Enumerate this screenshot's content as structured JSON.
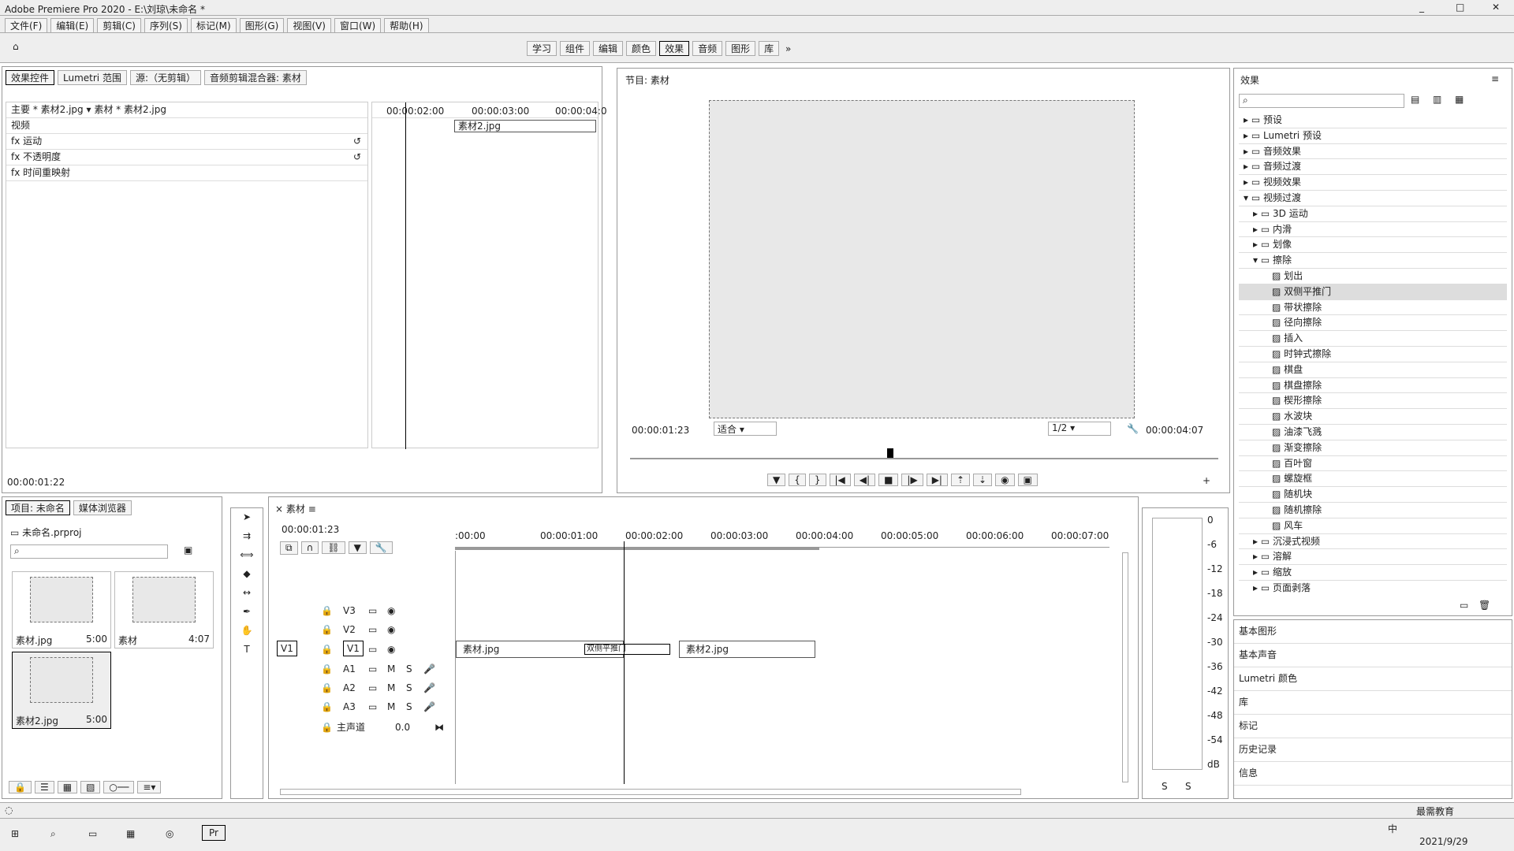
{
  "window": {
    "title": "Adobe Premiere Pro 2020 - E:\\刘琼\\未命名 *"
  },
  "menu": [
    "文件(F)",
    "编辑(E)",
    "剪辑(C)",
    "序列(S)",
    "标记(M)",
    "图形(G)",
    "视图(V)",
    "窗口(W)",
    "帮助(H)"
  ],
  "workspaces": {
    "items": [
      "学习",
      "组件",
      "编辑",
      "颜色",
      "效果",
      "音频",
      "图形",
      "库"
    ],
    "active": "效果"
  },
  "effect_controls": {
    "tabs": [
      "效果控件",
      "Lumetri 范围",
      "源:（无剪辑）",
      "音频剪辑混合器: 素材"
    ],
    "master": "主要 * 素材2.jpg",
    "clip": "素材 * 素材2.jpg",
    "ruler": [
      "00:00:02:00",
      "00:00:03:00",
      "00:00:04:0"
    ],
    "clip_label": "素材2.jpg",
    "section": "视频",
    "props": [
      "运动",
      "不透明度",
      "时间重映射"
    ],
    "fx": "fx",
    "timecode": "00:00:01:22"
  },
  "program": {
    "title": "节目: 素材",
    "timecode": "00:00:01:23",
    "fit": "适合",
    "quality": "1/2",
    "duration": "00:00:04:07"
  },
  "effects_panel": {
    "title": "效果",
    "tree": [
      {
        "label": "预设",
        "level": 0
      },
      {
        "label": "Lumetri 预设",
        "level": 0
      },
      {
        "label": "音频效果",
        "level": 0
      },
      {
        "label": "音频过渡",
        "level": 0
      },
      {
        "label": "视频效果",
        "level": 0
      },
      {
        "label": "视频过渡",
        "level": 0
      },
      {
        "label": "3D 运动",
        "level": 1
      },
      {
        "label": "内滑",
        "level": 1
      },
      {
        "label": "划像",
        "level": 1
      },
      {
        "label": "擦除",
        "level": 1
      },
      {
        "label": "划出",
        "level": 2
      },
      {
        "label": "双侧平推门",
        "level": 2,
        "selected": true
      },
      {
        "label": "带状擦除",
        "level": 2
      },
      {
        "label": "径向擦除",
        "level": 2
      },
      {
        "label": "插入",
        "level": 2
      },
      {
        "label": "时钟式擦除",
        "level": 2
      },
      {
        "label": "棋盘",
        "level": 2
      },
      {
        "label": "棋盘擦除",
        "level": 2
      },
      {
        "label": "楔形擦除",
        "level": 2
      },
      {
        "label": "水波块",
        "level": 2
      },
      {
        "label": "油漆飞溅",
        "level": 2
      },
      {
        "label": "渐变擦除",
        "level": 2
      },
      {
        "label": "百叶窗",
        "level": 2
      },
      {
        "label": "螺旋框",
        "level": 2
      },
      {
        "label": "随机块",
        "level": 2
      },
      {
        "label": "随机擦除",
        "level": 2
      },
      {
        "label": "风车",
        "level": 2
      },
      {
        "label": "沉浸式视频",
        "level": 1
      },
      {
        "label": "溶解",
        "level": 1
      },
      {
        "label": "缩放",
        "level": 1
      },
      {
        "label": "页面剥落",
        "level": 1
      }
    ],
    "sections": [
      "基本图形",
      "基本声音",
      "Lumetri 颜色",
      "库",
      "标记",
      "历史记录",
      "信息"
    ]
  },
  "project": {
    "tabs": [
      "项目: 未命名",
      "媒体浏览器"
    ],
    "file": "未命名.prproj",
    "items": [
      {
        "name": "素材.jpg",
        "duration": "5:00"
      },
      {
        "name": "素材",
        "duration": "4:07"
      },
      {
        "name": "素材2.jpg",
        "duration": "5:00"
      }
    ]
  },
  "timeline": {
    "title": "素材",
    "timecode": "00:00:01:23",
    "ruler": [
      ":00:00",
      "00:00:01:00",
      "00:00:02:00",
      "00:00:03:00",
      "00:00:04:00",
      "00:00:05:00",
      "00:00:06:00",
      "00:00:07:00"
    ],
    "video_tracks": [
      "V3",
      "V2",
      "V1"
    ],
    "audio_tracks": [
      "A1",
      "A2",
      "A3"
    ],
    "master": {
      "label": "主声道",
      "value": "0.0"
    },
    "clips": [
      {
        "name": "素材.jpg",
        "start": 0,
        "end": 1.95
      },
      {
        "name": "素材2.jpg",
        "start": 2.6,
        "end": 4.2
      }
    ],
    "transition": {
      "name": "双侧平推门",
      "start": 1.5,
      "end": 2.5
    },
    "playhead": 1.96,
    "time_max": 7.7,
    "source_patch": "V1"
  },
  "meter_scale": [
    "0",
    "-6",
    "-12",
    "-18",
    "-24",
    "-30",
    "-36",
    "-42",
    "-48",
    "-54",
    "dB"
  ],
  "meter_solo": [
    "S",
    "S"
  ],
  "taskbar": {
    "date": "2021/9/29",
    "ime": "中",
    "watermark": "最需教育"
  }
}
